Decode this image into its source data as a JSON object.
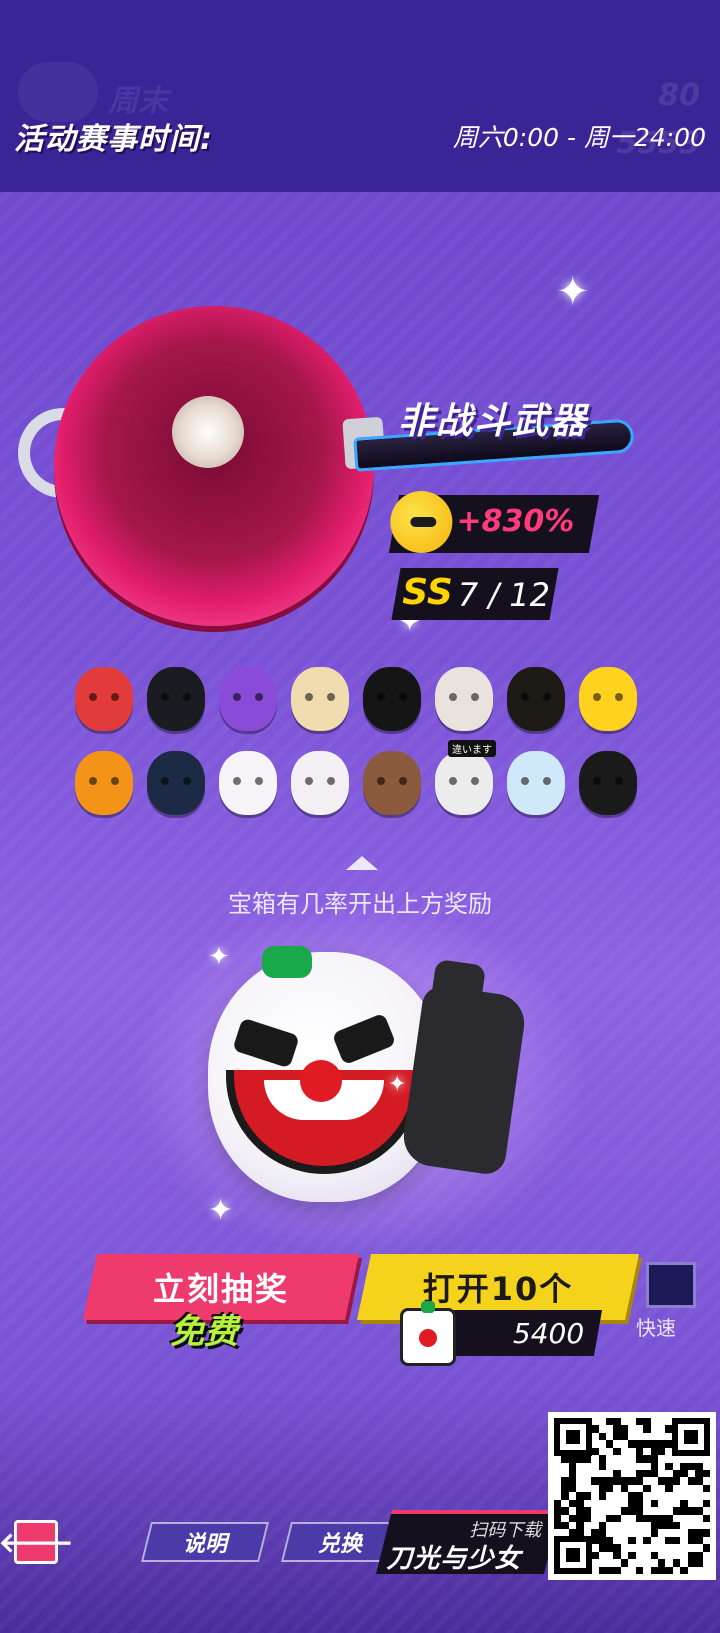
{
  "header": {
    "event_label": "活动赛事时间:",
    "event_time": "周六0:00 - 周一24:00",
    "ghost_title": "周末",
    "ghost_num_1": "80",
    "ghost_num_2": "5553"
  },
  "featured": {
    "weapon_type": "非战斗武器",
    "bonus": "+830%",
    "rank": "SS",
    "rank_count": "7 / 12"
  },
  "rewards": {
    "hint": "宝箱有几率开出上方奖励",
    "rare_tag": "違います",
    "items": [
      {
        "icon": "nutcracker-head-icon",
        "color": "#e23b3b"
      },
      {
        "icon": "halo-bowl-cut-head-icon",
        "color": "#1b1b22"
      },
      {
        "icon": "purple-rider-helmet-icon",
        "color": "#8a4bd8"
      },
      {
        "icon": "blonde-hair-head-icon",
        "color": "#f1dcb0"
      },
      {
        "icon": "black-bunny-head-icon",
        "color": "#151515"
      },
      {
        "icon": "horned-skull-mask-icon",
        "color": "#e8e3dc"
      },
      {
        "icon": "gold-visor-helmet-icon",
        "color": "#1e1a16"
      },
      {
        "icon": "yellow-block-head-icon",
        "color": "#ffd21f"
      },
      {
        "icon": "pumpkin-head-icon",
        "color": "#f39418"
      },
      {
        "icon": "cyber-visor-helmet-icon",
        "color": "#1c2a46"
      },
      {
        "icon": "white-bunny-head-icon",
        "color": "#f7f4f8"
      },
      {
        "icon": "clown-head-icon",
        "color": "#f3f0f4"
      },
      {
        "icon": "bear-head-icon",
        "color": "#8b5a3c"
      },
      {
        "icon": "box-head-icon",
        "color": "#ececec"
      },
      {
        "icon": "fish-head-icon",
        "color": "#cfe9fb"
      },
      {
        "icon": "reaper-hood-icon",
        "color": "#1a1a1a"
      }
    ]
  },
  "actions": {
    "draw_label": "立刻抽奖",
    "free_label": "免费",
    "open_ten_label": "打开10个",
    "open_ten_cost": "5400",
    "quick_label": "快速"
  },
  "footer": {
    "back_glyph": "🡐",
    "help_label": "说明",
    "exchange_label": "兑换",
    "scan_label": "扫码下载",
    "game_name": "刀光与少女"
  },
  "colors": {
    "accent_pink": "#ef3a6e",
    "accent_yellow": "#f5d21c",
    "free_green": "#b8f23a",
    "topbar": "#3a2596"
  }
}
